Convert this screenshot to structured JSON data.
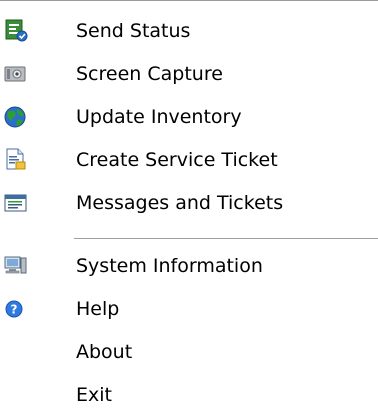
{
  "menu": {
    "items": [
      {
        "label": "Send Status",
        "icon": "send-status-icon"
      },
      {
        "label": "Screen Capture",
        "icon": "camera-icon"
      },
      {
        "label": "Update Inventory",
        "icon": "globe-icon"
      },
      {
        "label": "Create Service Ticket",
        "icon": "ticket-document-icon"
      },
      {
        "label": "Messages and Tickets",
        "icon": "messages-list-icon"
      },
      {
        "label": "System Information",
        "icon": "computer-icon"
      },
      {
        "label": "Help",
        "icon": "help-icon"
      },
      {
        "label": "About",
        "icon": ""
      },
      {
        "label": "Exit",
        "icon": ""
      }
    ]
  },
  "colors": {
    "separator": "#a0a0a0",
    "top_border": "#9a9a9a",
    "help_blue": "#2f7ae0",
    "globe_green": "#2e9f2e",
    "globe_blue": "#2a6fc9"
  }
}
